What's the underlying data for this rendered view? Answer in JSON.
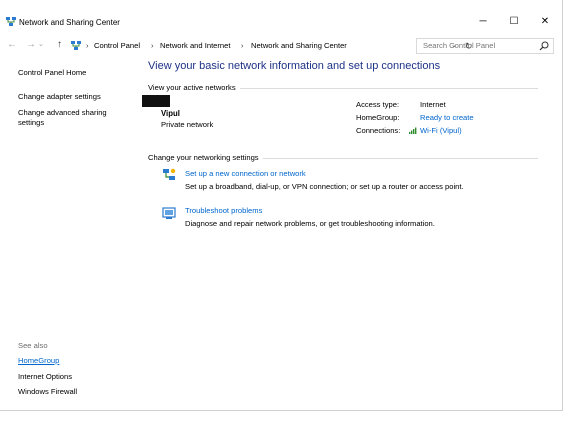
{
  "window": {
    "title": "Network and Sharing Center",
    "minimize": "─",
    "maximize": "☐",
    "close": "✕"
  },
  "nav": {
    "back": "←",
    "forward": "→",
    "up": "↑",
    "breadcrumb": [
      "Control Panel",
      "Network and Internet",
      "Network and Sharing Center"
    ],
    "search_placeholder": "Search Control Panel"
  },
  "left_pane": {
    "home": "Control Panel Home",
    "links": [
      "Change adapter settings",
      "Change advanced sharing settings"
    ],
    "see_also_label": "See also",
    "see_also": [
      "HomeGroup",
      "Internet Options",
      "Windows Firewall"
    ]
  },
  "main": {
    "title": "View your basic network information and set up connections",
    "active_section": "View your active networks",
    "network": {
      "name": "Vipul",
      "type": "Private network",
      "access_type_label": "Access type:",
      "access_type_value": "Internet",
      "homegroup_label": "HomeGroup:",
      "homegroup_value": "Ready to create",
      "connections_label": "Connections:",
      "connections_value": "Wi-Fi (Vipul)"
    },
    "change_section": "Change your networking settings",
    "tasks": [
      {
        "link": "Set up a new connection or network",
        "desc": "Set up a broadband, dial-up, or VPN connection; or set up a router or access point.",
        "icon": "new-connection-icon"
      },
      {
        "link": "Troubleshoot problems",
        "desc": "Diagnose and repair network problems, or get troubleshooting information.",
        "icon": "troubleshoot-icon"
      }
    ]
  },
  "colors": {
    "link": "#0066cc",
    "title_blue": "#1e3287",
    "divider": "#dcdcdc"
  }
}
